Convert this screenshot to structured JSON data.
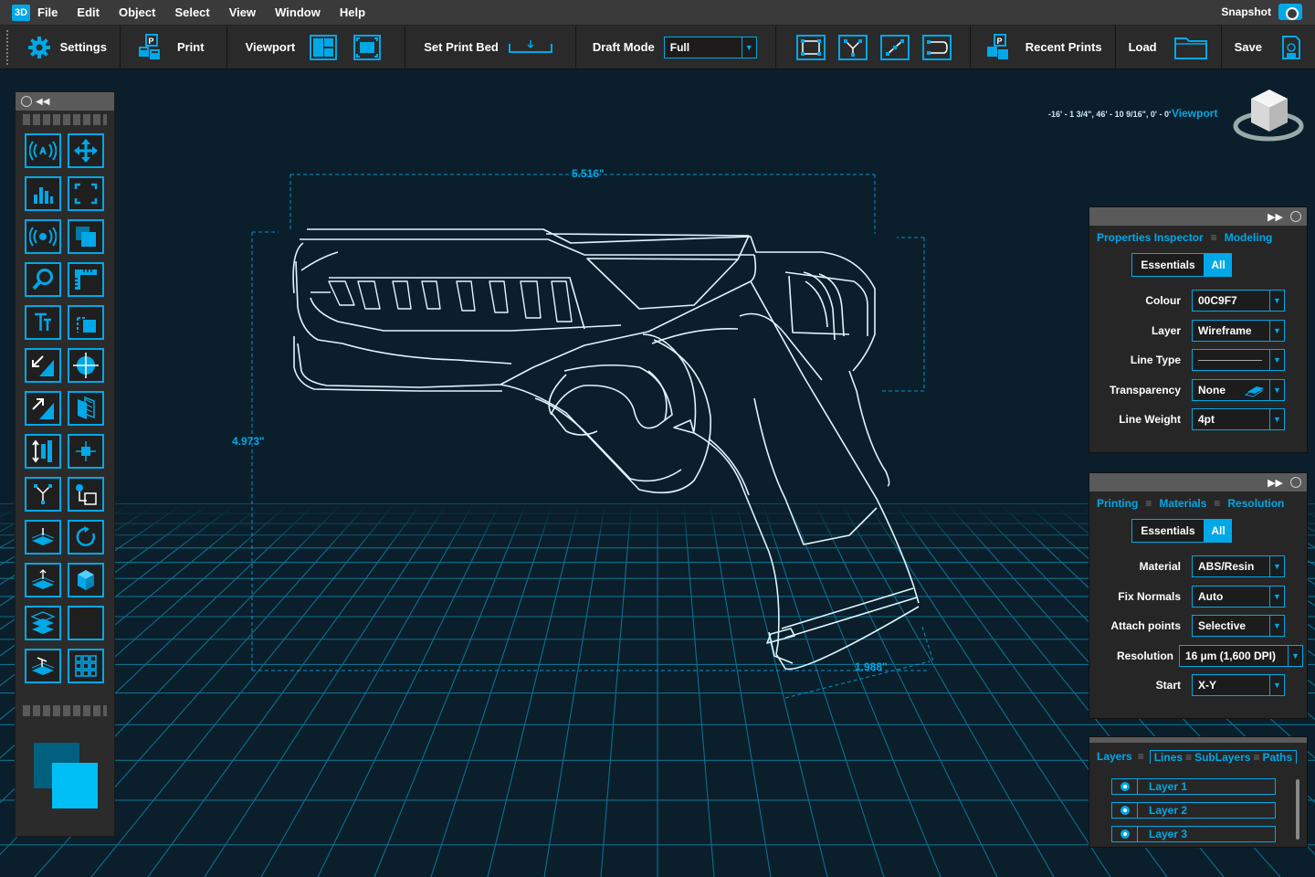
{
  "app": {
    "badge": "3D"
  },
  "menu": [
    "File",
    "Edit",
    "Object",
    "Select",
    "View",
    "Window",
    "Help"
  ],
  "snapshot_label": "Snapshot",
  "toolbar": {
    "settings": "Settings",
    "print": "Print",
    "viewport": "Viewport",
    "set_print_bed": "Set Print Bed",
    "draft_mode": "Draft Mode",
    "draft_value": "Full",
    "recent_prints": "Recent Prints",
    "load": "Load",
    "save": "Save"
  },
  "canvas": {
    "dim_width": "5.516\"",
    "dim_height": "4.973\"",
    "dim_depth": "1.988\"",
    "coords": "-16' - 1 3/4\", 46' - 10 9/16\", 0' - 0'",
    "viewport_label": "Viewport"
  },
  "properties": {
    "tab1": "Properties Inspector",
    "tab2": "Modeling",
    "seg_a": "Essentials",
    "seg_b": "All",
    "rows": [
      {
        "label": "Colour",
        "value": "00C9F7"
      },
      {
        "label": "Layer",
        "value": "Wireframe"
      },
      {
        "label": "Line Type",
        "value": ""
      },
      {
        "label": "Transparency",
        "value": "None"
      },
      {
        "label": "Line Weight",
        "value": "4pt"
      }
    ]
  },
  "printing": {
    "tab1": "Printing",
    "tab2": "Materials",
    "tab3": "Resolution",
    "seg_a": "Essentials",
    "seg_b": "All",
    "rows": [
      {
        "label": "Material",
        "value": "ABS/Resin"
      },
      {
        "label": "Fix Normals",
        "value": "Auto"
      },
      {
        "label": "Attach points",
        "value": "Selective"
      },
      {
        "label": "Resolution",
        "value": "16 µm (1,600 DPI)"
      },
      {
        "label": "Start",
        "value": "X-Y"
      }
    ]
  },
  "layers": {
    "tab1": "Layers",
    "tab2": "Lines",
    "tab3": "SubLayers",
    "tab4": "Paths",
    "items": [
      "Layer 1",
      "Layer 2",
      "Layer 3"
    ]
  },
  "colors": {
    "accent": "#00a8e8",
    "wire": "#dff6ff",
    "grid": "#0f6f8c",
    "bg": "#0a1f2b"
  }
}
